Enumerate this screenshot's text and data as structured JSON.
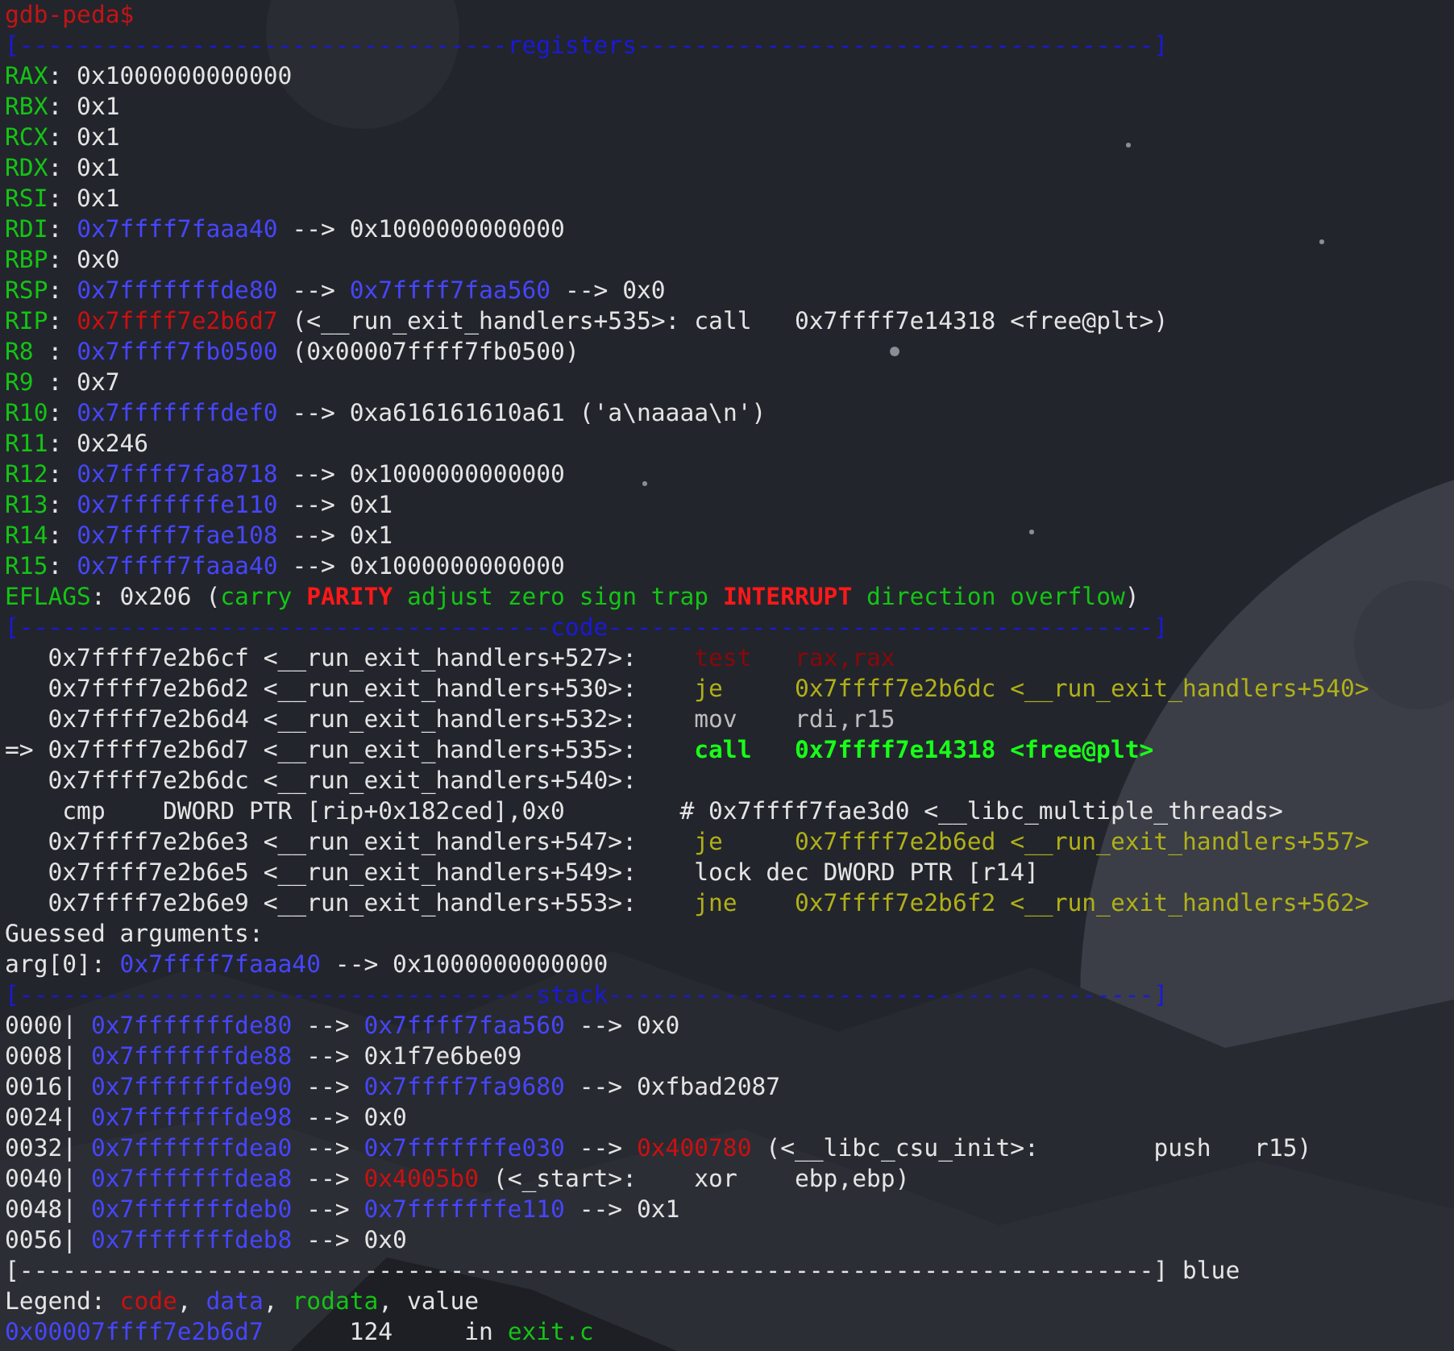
{
  "terminal": {
    "lines": [
      [
        {
          "text": "gdb-peda$",
          "kind": "prompt"
        }
      ],
      [
        {
          "text": "[----------------------------------registers------------------------------------]",
          "kind": "rule"
        }
      ],
      [
        {
          "text": "RAX",
          "kind": "label"
        },
        {
          "text": ": 0x1000000000000",
          "kind": "plain"
        }
      ],
      [
        {
          "text": "RBX",
          "kind": "label"
        },
        {
          "text": ": 0x1",
          "kind": "plain"
        }
      ],
      [
        {
          "text": "RCX",
          "kind": "label"
        },
        {
          "text": ": 0x1",
          "kind": "plain"
        }
      ],
      [
        {
          "text": "RDX",
          "kind": "label"
        },
        {
          "text": ": 0x1",
          "kind": "plain"
        }
      ],
      [
        {
          "text": "RSI",
          "kind": "label"
        },
        {
          "text": ": 0x1",
          "kind": "plain"
        }
      ],
      [
        {
          "text": "RDI",
          "kind": "label"
        },
        {
          "text": ": ",
          "kind": "plain"
        },
        {
          "text": "0x7ffff7faaa40",
          "kind": "pointer"
        },
        {
          "text": " --> 0x1000000000000",
          "kind": "plain"
        }
      ],
      [
        {
          "text": "RBP",
          "kind": "label"
        },
        {
          "text": ": 0x0",
          "kind": "plain"
        }
      ],
      [
        {
          "text": "RSP",
          "kind": "label"
        },
        {
          "text": ": ",
          "kind": "plain"
        },
        {
          "text": "0x7fffffffde80",
          "kind": "pointer"
        },
        {
          "text": " --> ",
          "kind": "plain"
        },
        {
          "text": "0x7ffff7faa560",
          "kind": "pointer"
        },
        {
          "text": " --> 0x0",
          "kind": "plain"
        }
      ],
      [
        {
          "text": "RIP",
          "kind": "label"
        },
        {
          "text": ": ",
          "kind": "plain"
        },
        {
          "text": "0x7ffff7e2b6d7",
          "kind": "code"
        },
        {
          "text": " (<__run_exit_handlers+535>: call   0x7ffff7e14318 <free@plt>)",
          "kind": "plain"
        }
      ],
      [
        {
          "text": "R8 ",
          "kind": "label"
        },
        {
          "text": ": ",
          "kind": "plain"
        },
        {
          "text": "0x7ffff7fb0500",
          "kind": "pointer"
        },
        {
          "text": " (0x00007ffff7fb0500)",
          "kind": "plain"
        }
      ],
      [
        {
          "text": "R9 ",
          "kind": "label"
        },
        {
          "text": ": 0x7",
          "kind": "plain"
        }
      ],
      [
        {
          "text": "R10",
          "kind": "label"
        },
        {
          "text": ": ",
          "kind": "plain"
        },
        {
          "text": "0x7fffffffdef0",
          "kind": "pointer"
        },
        {
          "text": " --> 0xa616161610a61 ('a\\naaaa\\n')",
          "kind": "plain"
        }
      ],
      [
        {
          "text": "R11",
          "kind": "label"
        },
        {
          "text": ": 0x246",
          "kind": "plain"
        }
      ],
      [
        {
          "text": "R12",
          "kind": "label"
        },
        {
          "text": ": ",
          "kind": "plain"
        },
        {
          "text": "0x7ffff7fa8718",
          "kind": "pointer"
        },
        {
          "text": " --> 0x1000000000000",
          "kind": "plain"
        }
      ],
      [
        {
          "text": "R13",
          "kind": "label"
        },
        {
          "text": ": ",
          "kind": "plain"
        },
        {
          "text": "0x7fffffffe110",
          "kind": "pointer"
        },
        {
          "text": " --> 0x1",
          "kind": "plain"
        }
      ],
      [
        {
          "text": "R14",
          "kind": "label"
        },
        {
          "text": ": ",
          "kind": "plain"
        },
        {
          "text": "0x7ffff7fae108",
          "kind": "pointer"
        },
        {
          "text": " --> 0x1",
          "kind": "plain"
        }
      ],
      [
        {
          "text": "R15",
          "kind": "label"
        },
        {
          "text": ": ",
          "kind": "plain"
        },
        {
          "text": "0x7ffff7faaa40",
          "kind": "pointer"
        },
        {
          "text": " --> 0x1000000000000",
          "kind": "plain"
        }
      ],
      [
        {
          "text": "EFLAGS",
          "kind": "label"
        },
        {
          "text": ": 0x206 (",
          "kind": "plain"
        },
        {
          "text": "carry ",
          "kind": "label"
        },
        {
          "text": "PARITY",
          "kind": "flag_set"
        },
        {
          "text": " adjust zero sign trap ",
          "kind": "label"
        },
        {
          "text": "INTERRUPT",
          "kind": "flag_set"
        },
        {
          "text": " direction overflow",
          "kind": "label"
        },
        {
          "text": ")",
          "kind": "plain"
        }
      ],
      [
        {
          "text": "[-------------------------------------code--------------------------------------]",
          "kind": "rule"
        }
      ],
      [
        {
          "text": "   0x7ffff7e2b6cf <__run_exit_handlers+527>:    ",
          "kind": "plain"
        },
        {
          "text": "test   rax,rax",
          "kind": "dark_code"
        }
      ],
      [
        {
          "text": "   0x7ffff7e2b6d2 <__run_exit_handlers+530>:    ",
          "kind": "plain"
        },
        {
          "text": "je     0x7ffff7e2b6dc <__run_exit_handlers+540>",
          "kind": "jump"
        }
      ],
      [
        {
          "text": "   0x7ffff7e2b6d4 <__run_exit_handlers+532>:    ",
          "kind": "plain"
        },
        {
          "text": "mov    rdi,r15",
          "kind": "dim"
        }
      ],
      [
        {
          "text": "=> 0x7ffff7e2b6d7 <__run_exit_handlers+535>:    ",
          "kind": "plain"
        },
        {
          "text": "call   0x7ffff7e14318 <free@plt>",
          "kind": "current"
        }
      ],
      [
        {
          "text": "   0x7ffff7e2b6dc <__run_exit_handlers+540>:",
          "kind": "plain"
        }
      ],
      [
        {
          "text": "    cmp    DWORD PTR [rip+0x182ced],0x0        # 0x7ffff7fae3d0 <__libc_multiple_threads>",
          "kind": "plain"
        }
      ],
      [
        {
          "text": "   0x7ffff7e2b6e3 <__run_exit_handlers+547>:    ",
          "kind": "plain"
        },
        {
          "text": "je     0x7ffff7e2b6ed <__run_exit_handlers+557>",
          "kind": "jump"
        }
      ],
      [
        {
          "text": "   0x7ffff7e2b6e5 <__run_exit_handlers+549>:    lock dec DWORD PTR [r14]",
          "kind": "plain"
        }
      ],
      [
        {
          "text": "   0x7ffff7e2b6e9 <__run_exit_handlers+553>:    ",
          "kind": "plain"
        },
        {
          "text": "jne    0x7ffff7e2b6f2 <__run_exit_handlers+562>",
          "kind": "jump"
        }
      ],
      [
        {
          "text": "Guessed arguments:",
          "kind": "plain"
        }
      ],
      [
        {
          "text": "arg[0]: ",
          "kind": "plain"
        },
        {
          "text": "0x7ffff7faaa40",
          "kind": "pointer"
        },
        {
          "text": " --> 0x1000000000000",
          "kind": "plain"
        }
      ],
      [
        {
          "text": "[------------------------------------stack--------------------------------------]",
          "kind": "rule"
        }
      ],
      [
        {
          "text": "0000| ",
          "kind": "plain"
        },
        {
          "text": "0x7fffffffde80",
          "kind": "pointer"
        },
        {
          "text": " --> ",
          "kind": "plain"
        },
        {
          "text": "0x7ffff7faa560",
          "kind": "pointer"
        },
        {
          "text": " --> 0x0",
          "kind": "plain"
        }
      ],
      [
        {
          "text": "0008| ",
          "kind": "plain"
        },
        {
          "text": "0x7fffffffde88",
          "kind": "pointer"
        },
        {
          "text": " --> 0x1f7e6be09",
          "kind": "plain"
        }
      ],
      [
        {
          "text": "0016| ",
          "kind": "plain"
        },
        {
          "text": "0x7fffffffde90",
          "kind": "pointer"
        },
        {
          "text": " --> ",
          "kind": "plain"
        },
        {
          "text": "0x7ffff7fa9680",
          "kind": "pointer"
        },
        {
          "text": " --> 0xfbad2087",
          "kind": "plain"
        }
      ],
      [
        {
          "text": "0024| ",
          "kind": "plain"
        },
        {
          "text": "0x7fffffffde98",
          "kind": "pointer"
        },
        {
          "text": " --> 0x0",
          "kind": "plain"
        }
      ],
      [
        {
          "text": "0032| ",
          "kind": "plain"
        },
        {
          "text": "0x7fffffffdea0",
          "kind": "pointer"
        },
        {
          "text": " --> ",
          "kind": "plain"
        },
        {
          "text": "0x7fffffffe030",
          "kind": "pointer"
        },
        {
          "text": " --> ",
          "kind": "plain"
        },
        {
          "text": "0x400780",
          "kind": "code"
        },
        {
          "text": " (<__libc_csu_init>:        push   r15)",
          "kind": "plain"
        }
      ],
      [
        {
          "text": "0040| ",
          "kind": "plain"
        },
        {
          "text": "0x7fffffffdea8",
          "kind": "pointer"
        },
        {
          "text": " --> ",
          "kind": "plain"
        },
        {
          "text": "0x4005b0",
          "kind": "code"
        },
        {
          "text": " (<_start>:    xor    ebp,ebp)",
          "kind": "plain"
        }
      ],
      [
        {
          "text": "0048| ",
          "kind": "plain"
        },
        {
          "text": "0x7fffffffdeb0",
          "kind": "pointer"
        },
        {
          "text": " --> ",
          "kind": "plain"
        },
        {
          "text": "0x7fffffffe110",
          "kind": "pointer"
        },
        {
          "text": " --> 0x1",
          "kind": "plain"
        }
      ],
      [
        {
          "text": "0056| ",
          "kind": "plain"
        },
        {
          "text": "0x7fffffffdeb8",
          "kind": "pointer"
        },
        {
          "text": " --> 0x0",
          "kind": "plain"
        }
      ],
      [
        {
          "text": "[-------------------------------------------------------------------------------] blue",
          "kind": "plain"
        }
      ],
      [
        {
          "text": "Legend: ",
          "kind": "plain"
        },
        {
          "text": "code",
          "kind": "code"
        },
        {
          "text": ", ",
          "kind": "plain"
        },
        {
          "text": "data",
          "kind": "pointer"
        },
        {
          "text": ", ",
          "kind": "plain"
        },
        {
          "text": "rodata",
          "kind": "label"
        },
        {
          "text": ", value",
          "kind": "plain"
        }
      ],
      [
        {
          "text": "0x00007ffff7e2b6d7",
          "kind": "pointer"
        },
        {
          "text": "      124     in ",
          "kind": "plain"
        },
        {
          "text": "exit.c",
          "kind": "label"
        }
      ]
    ]
  }
}
